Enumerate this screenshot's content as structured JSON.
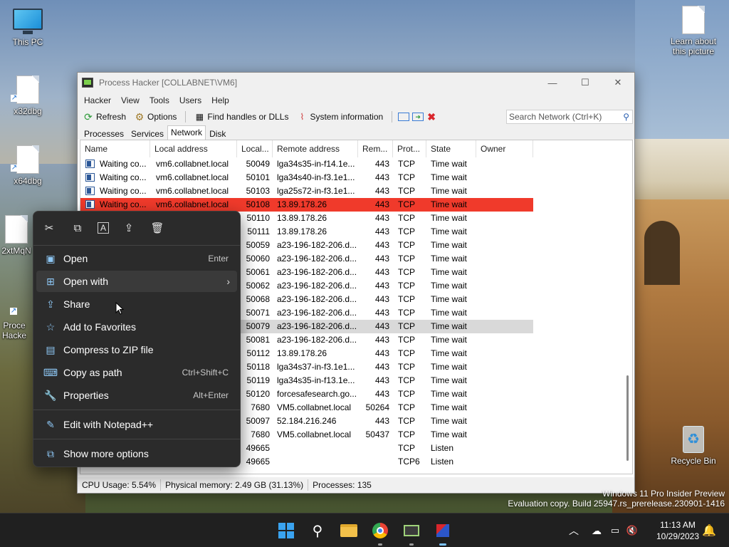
{
  "desktop": {
    "icons": [
      {
        "label": "This PC"
      },
      {
        "label": "x32dbg"
      },
      {
        "label": "x64dbg"
      },
      {
        "label": "2xtMqN"
      },
      {
        "label": "Proce Hacke"
      },
      {
        "label": "Learn about this picture"
      },
      {
        "label": "Recycle Bin"
      }
    ]
  },
  "window": {
    "title": "Process Hacker [COLLABNET\\VM6]",
    "menu": [
      "Hacker",
      "View",
      "Tools",
      "Users",
      "Help"
    ],
    "toolbar": {
      "refresh": "Refresh",
      "options": "Options",
      "find_handles": "Find handles or DLLs",
      "system_info": "System information",
      "search_placeholder": "Search Network (Ctrl+K)"
    },
    "tabs": [
      "Processes",
      "Services",
      "Network",
      "Disk"
    ],
    "active_tab": "Network",
    "columns": [
      "Name",
      "Local address",
      "Local...",
      "Remote address",
      "Rem...",
      "Prot...",
      "State",
      "Owner"
    ],
    "rows": [
      {
        "name": "Waiting co...",
        "local_addr": "vm6.collabnet.local",
        "local_port": "50049",
        "remote_addr": "lga34s35-in-f14.1e...",
        "remote_port": "443",
        "proto": "TCP",
        "state": "Time wait"
      },
      {
        "name": "Waiting co...",
        "local_addr": "vm6.collabnet.local",
        "local_port": "50101",
        "remote_addr": "lga34s40-in-f3.1e1...",
        "remote_port": "443",
        "proto": "TCP",
        "state": "Time wait"
      },
      {
        "name": "Waiting co...",
        "local_addr": "vm6.collabnet.local",
        "local_port": "50103",
        "remote_addr": "lga25s72-in-f3.1e1...",
        "remote_port": "443",
        "proto": "TCP",
        "state": "Time wait"
      },
      {
        "name": "Waiting co...",
        "local_addr": "vm6.collabnet.local",
        "local_port": "50108",
        "remote_addr": "13.89.178.26",
        "remote_port": "443",
        "proto": "TCP",
        "state": "Time wait"
      },
      {
        "name": "",
        "local_addr": "",
        "local_port": "50110",
        "remote_addr": "13.89.178.26",
        "remote_port": "443",
        "proto": "TCP",
        "state": "Time wait"
      },
      {
        "name": "",
        "local_addr": "",
        "local_port": "50111",
        "remote_addr": "13.89.178.26",
        "remote_port": "443",
        "proto": "TCP",
        "state": "Time wait"
      },
      {
        "name": "",
        "local_addr": "",
        "local_port": "50059",
        "remote_addr": "a23-196-182-206.d...",
        "remote_port": "443",
        "proto": "TCP",
        "state": "Time wait"
      },
      {
        "name": "",
        "local_addr": "",
        "local_port": "50060",
        "remote_addr": "a23-196-182-206.d...",
        "remote_port": "443",
        "proto": "TCP",
        "state": "Time wait"
      },
      {
        "name": "",
        "local_addr": "",
        "local_port": "50061",
        "remote_addr": "a23-196-182-206.d...",
        "remote_port": "443",
        "proto": "TCP",
        "state": "Time wait"
      },
      {
        "name": "",
        "local_addr": "",
        "local_port": "50062",
        "remote_addr": "a23-196-182-206.d...",
        "remote_port": "443",
        "proto": "TCP",
        "state": "Time wait"
      },
      {
        "name": "",
        "local_addr": "",
        "local_port": "50068",
        "remote_addr": "a23-196-182-206.d...",
        "remote_port": "443",
        "proto": "TCP",
        "state": "Time wait"
      },
      {
        "name": "",
        "local_addr": "",
        "local_port": "50071",
        "remote_addr": "a23-196-182-206.d...",
        "remote_port": "443",
        "proto": "TCP",
        "state": "Time wait"
      },
      {
        "name": "",
        "local_addr": "",
        "local_port": "50079",
        "remote_addr": "a23-196-182-206.d...",
        "remote_port": "443",
        "proto": "TCP",
        "state": "Time wait"
      },
      {
        "name": "",
        "local_addr": "",
        "local_port": "50081",
        "remote_addr": "a23-196-182-206.d...",
        "remote_port": "443",
        "proto": "TCP",
        "state": "Time wait"
      },
      {
        "name": "",
        "local_addr": "",
        "local_port": "50112",
        "remote_addr": "13.89.178.26",
        "remote_port": "443",
        "proto": "TCP",
        "state": "Time wait"
      },
      {
        "name": "",
        "local_addr": "",
        "local_port": "50118",
        "remote_addr": "lga34s37-in-f3.1e1...",
        "remote_port": "443",
        "proto": "TCP",
        "state": "Time wait"
      },
      {
        "name": "",
        "local_addr": "",
        "local_port": "50119",
        "remote_addr": "lga34s35-in-f13.1e...",
        "remote_port": "443",
        "proto": "TCP",
        "state": "Time wait"
      },
      {
        "name": "",
        "local_addr": "",
        "local_port": "50120",
        "remote_addr": "forcesafesearch.go...",
        "remote_port": "443",
        "proto": "TCP",
        "state": "Time wait"
      },
      {
        "name": "",
        "local_addr": "",
        "local_port": "7680",
        "remote_addr": "VM5.collabnet.local",
        "remote_port": "50264",
        "proto": "TCP",
        "state": "Time wait"
      },
      {
        "name": "",
        "local_addr": "",
        "local_port": "50097",
        "remote_addr": "52.184.216.246",
        "remote_port": "443",
        "proto": "TCP",
        "state": "Time wait"
      },
      {
        "name": "",
        "local_addr": "",
        "local_port": "7680",
        "remote_addr": "VM5.collabnet.local",
        "remote_port": "50437",
        "proto": "TCP",
        "state": "Time wait"
      },
      {
        "name": "",
        "local_addr": "",
        "local_port": "49665",
        "remote_addr": "",
        "remote_port": "",
        "proto": "TCP",
        "state": "Listen"
      },
      {
        "name": "",
        "local_addr": "",
        "local_port": "49665",
        "remote_addr": "",
        "remote_port": "",
        "proto": "TCP6",
        "state": "Listen"
      }
    ],
    "selected_row_index": 3,
    "hover_row_index": 12,
    "statusbar": {
      "cpu": "CPU Usage: 5.54%",
      "memory": "Physical memory: 2.49 GB (31.13%)",
      "processes": "Processes: 135"
    }
  },
  "context_menu": {
    "top_actions": [
      "cut-icon",
      "copy-icon",
      "rename-icon",
      "share-icon",
      "delete-icon"
    ],
    "items": [
      {
        "label": "Open",
        "shortcut": "Enter",
        "icon": "app-icon"
      },
      {
        "label": "Open with",
        "shortcut": "",
        "icon": "open-with-icon",
        "submenu": true
      },
      {
        "label": "Share",
        "shortcut": "",
        "icon": "share-icon"
      },
      {
        "label": "Add to Favorites",
        "shortcut": "",
        "icon": "star-icon"
      },
      {
        "label": "Compress to ZIP file",
        "shortcut": "",
        "icon": "zip-icon"
      },
      {
        "label": "Copy as path",
        "shortcut": "Ctrl+Shift+C",
        "icon": "path-icon"
      },
      {
        "label": "Properties",
        "shortcut": "Alt+Enter",
        "icon": "wrench-icon"
      },
      {
        "label": "Edit with Notepad++",
        "shortcut": "",
        "icon": "notepad-icon"
      },
      {
        "label": "Show more options",
        "shortcut": "",
        "icon": "more-options-icon"
      }
    ],
    "highlighted_index": 1
  },
  "watermark": {
    "line1": "Windows 11 Pro Insider Preview",
    "line2": "Evaluation copy. Build 25947.rs_prerelease.230901-1416"
  },
  "taskbar": {
    "clock_time": "11:13 AM",
    "clock_date": "10/29/2023"
  },
  "colors": {
    "selected_row": "#f03a2b",
    "menu_bg": "#2b2b2b",
    "taskbar_bg": "#202020"
  }
}
